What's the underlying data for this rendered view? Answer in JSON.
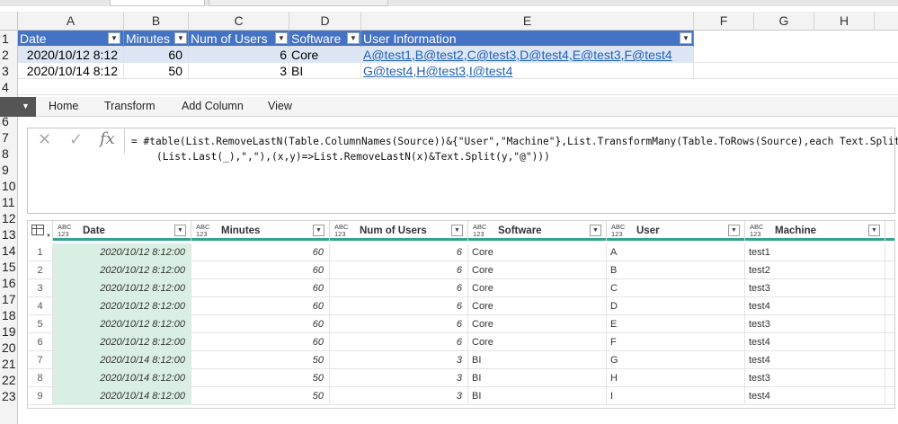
{
  "excel": {
    "columns": [
      "A",
      "B",
      "C",
      "D",
      "E",
      "F",
      "G",
      "H"
    ],
    "table_headers": [
      "Date",
      "Minutes",
      "Num of Users",
      "Software",
      "User Information"
    ],
    "rows": [
      {
        "date": "2020/10/12 8:12",
        "minutes": "60",
        "users": "6",
        "software": "Core",
        "info": "A@test1,B@test2,C@test3,D@test4,E@test3,F@test4"
      },
      {
        "date": "2020/10/14 8:12",
        "minutes": "50",
        "users": "3",
        "software": "BI",
        "info": "G@test4,H@test3,I@test4"
      }
    ],
    "row_numbers": [
      "1",
      "2",
      "3",
      "4",
      "5",
      "6",
      "7",
      "8",
      "9",
      "10",
      "11",
      "12",
      "13",
      "14",
      "15",
      "16",
      "17",
      "18",
      "19",
      "20",
      "21",
      "22",
      "23"
    ]
  },
  "power_query": {
    "menu": [
      "Home",
      "Transform",
      "Add Column",
      "View"
    ],
    "formula_line1": "= #table(List.RemoveLastN(Table.ColumnNames(Source))&{\"User\",\"Machine\"},List.TransformMany(Table.ToRows(Source),each Text.Split",
    "formula_line2": "(List.Last(_),\",\"),(x,y)=>List.RemoveLastN(x)&Text.Split(y,\"@\")))",
    "columns": [
      "Date",
      "Minutes",
      "Num of Users",
      "Software",
      "User",
      "Machine"
    ],
    "type_badge_top": "ABC",
    "type_badge_bottom": "123",
    "rows": [
      [
        "1",
        "2020/10/12 8:12:00",
        "60",
        "6",
        "Core",
        "A",
        "test1"
      ],
      [
        "2",
        "2020/10/12 8:12:00",
        "60",
        "6",
        "Core",
        "B",
        "test2"
      ],
      [
        "3",
        "2020/10/12 8:12:00",
        "60",
        "6",
        "Core",
        "C",
        "test3"
      ],
      [
        "4",
        "2020/10/12 8:12:00",
        "60",
        "6",
        "Core",
        "D",
        "test4"
      ],
      [
        "5",
        "2020/10/12 8:12:00",
        "60",
        "6",
        "Core",
        "E",
        "test3"
      ],
      [
        "6",
        "2020/10/12 8:12:00",
        "60",
        "6",
        "Core",
        "F",
        "test4"
      ],
      [
        "7",
        "2020/10/14 8:12:00",
        "50",
        "3",
        "BI",
        "G",
        "test4"
      ],
      [
        "8",
        "2020/10/14 8:12:00",
        "50",
        "3",
        "BI",
        "H",
        "test3"
      ],
      [
        "9",
        "2020/10/14 8:12:00",
        "50",
        "3",
        "BI",
        "I",
        "test4"
      ]
    ]
  },
  "colors": {
    "table_header": "#4472c4",
    "accent_teal": "#33a48f",
    "date_column": "#d9efe4",
    "link": "#1f5fb8"
  }
}
